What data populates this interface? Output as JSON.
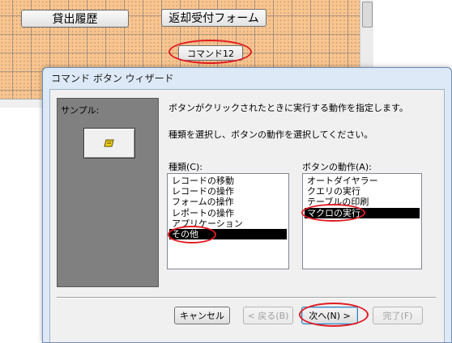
{
  "form": {
    "history_button": "貸出履歴",
    "return_button": "返却受付フォーム",
    "command_button": "コマンド12"
  },
  "wizard": {
    "title": "コマンド ボタン ウィザード",
    "sample_label": "サンプル:",
    "instruction1": "ボタンがクリックされたときに実行する動作を指定します。",
    "instruction2": "種類を選択し、ボタンの動作を選択してください。",
    "category_label": "種類(C):",
    "categories": [
      "レコードの移動",
      "レコードの操作",
      "フォームの操作",
      "レポートの操作",
      "アプリケーション",
      "その他"
    ],
    "selected_category": "その他",
    "action_label": "ボタンの動作(A):",
    "actions": [
      "オートダイヤラー",
      "クエリの実行",
      "テーブルの印刷",
      "マクロの実行"
    ],
    "selected_action": "マクロの実行",
    "buttons": {
      "cancel": "キャンセル",
      "back": "< 戻る(B)",
      "next": "次へ(N) >",
      "finish": "完了(F)"
    }
  },
  "colors": {
    "grid_background": "#f9c48e",
    "dialog_frame": "#dde9f6",
    "highlight_ellipse": "#e11b22",
    "selection": "#000000"
  }
}
